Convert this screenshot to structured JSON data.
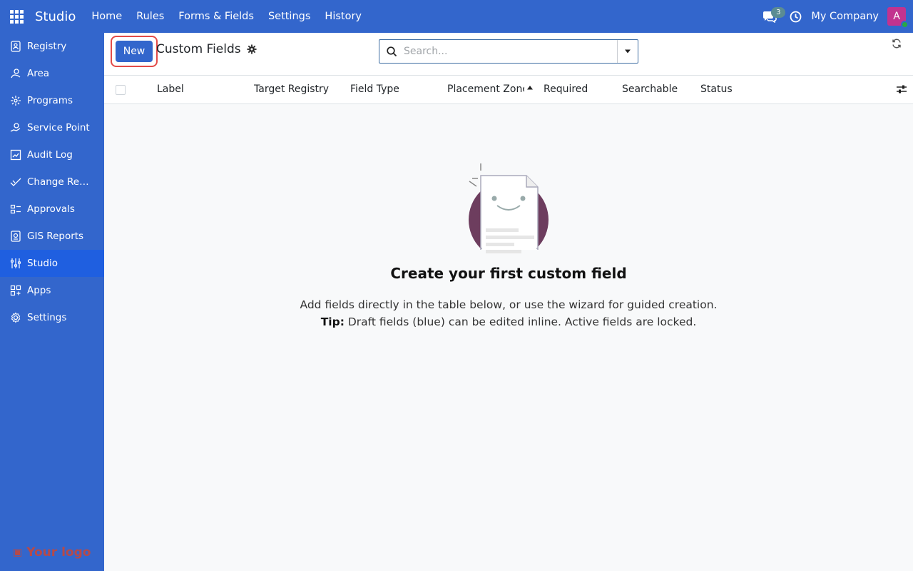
{
  "topbar": {
    "app_name": "Studio",
    "nav": [
      "Home",
      "Rules",
      "Forms & Fields",
      "Settings",
      "History"
    ],
    "chat_count": "3",
    "company": "My Company",
    "avatar_letter": "A"
  },
  "sidebar": {
    "items": [
      {
        "label": "Registry",
        "icon": "registry-icon"
      },
      {
        "label": "Area",
        "icon": "area-icon"
      },
      {
        "label": "Programs",
        "icon": "programs-icon"
      },
      {
        "label": "Service Point",
        "icon": "service-point-icon"
      },
      {
        "label": "Audit Log",
        "icon": "audit-log-icon"
      },
      {
        "label": "Change Req...",
        "icon": "change-request-icon"
      },
      {
        "label": "Approvals",
        "icon": "approvals-icon"
      },
      {
        "label": "GIS Reports",
        "icon": "gis-reports-icon"
      },
      {
        "label": "Studio",
        "icon": "studio-icon",
        "active": true
      },
      {
        "label": "Apps",
        "icon": "apps-icon"
      },
      {
        "label": "Settings",
        "icon": "settings-icon"
      }
    ],
    "logo_text": "Your logo"
  },
  "control": {
    "new_label": "New",
    "title": "Custom Fields",
    "search_placeholder": "Search..."
  },
  "table": {
    "columns": [
      "Label",
      "Target Registry",
      "Field Type",
      "Placement Zone",
      "Required",
      "Searchable",
      "Status"
    ]
  },
  "empty_state": {
    "title": "Create your first custom field",
    "line1": "Add fields directly in the table below, or use the wizard for guided creation.",
    "tip_label": "Tip:",
    "tip_text": " Draft fields (blue) can be edited inline. Active fields are locked."
  },
  "colors": {
    "brand": "#3366cc",
    "active": "#1f5fe0",
    "highlight": "#e34b48",
    "avatar": "#c2338f",
    "illustration": "#6d3d5e"
  }
}
